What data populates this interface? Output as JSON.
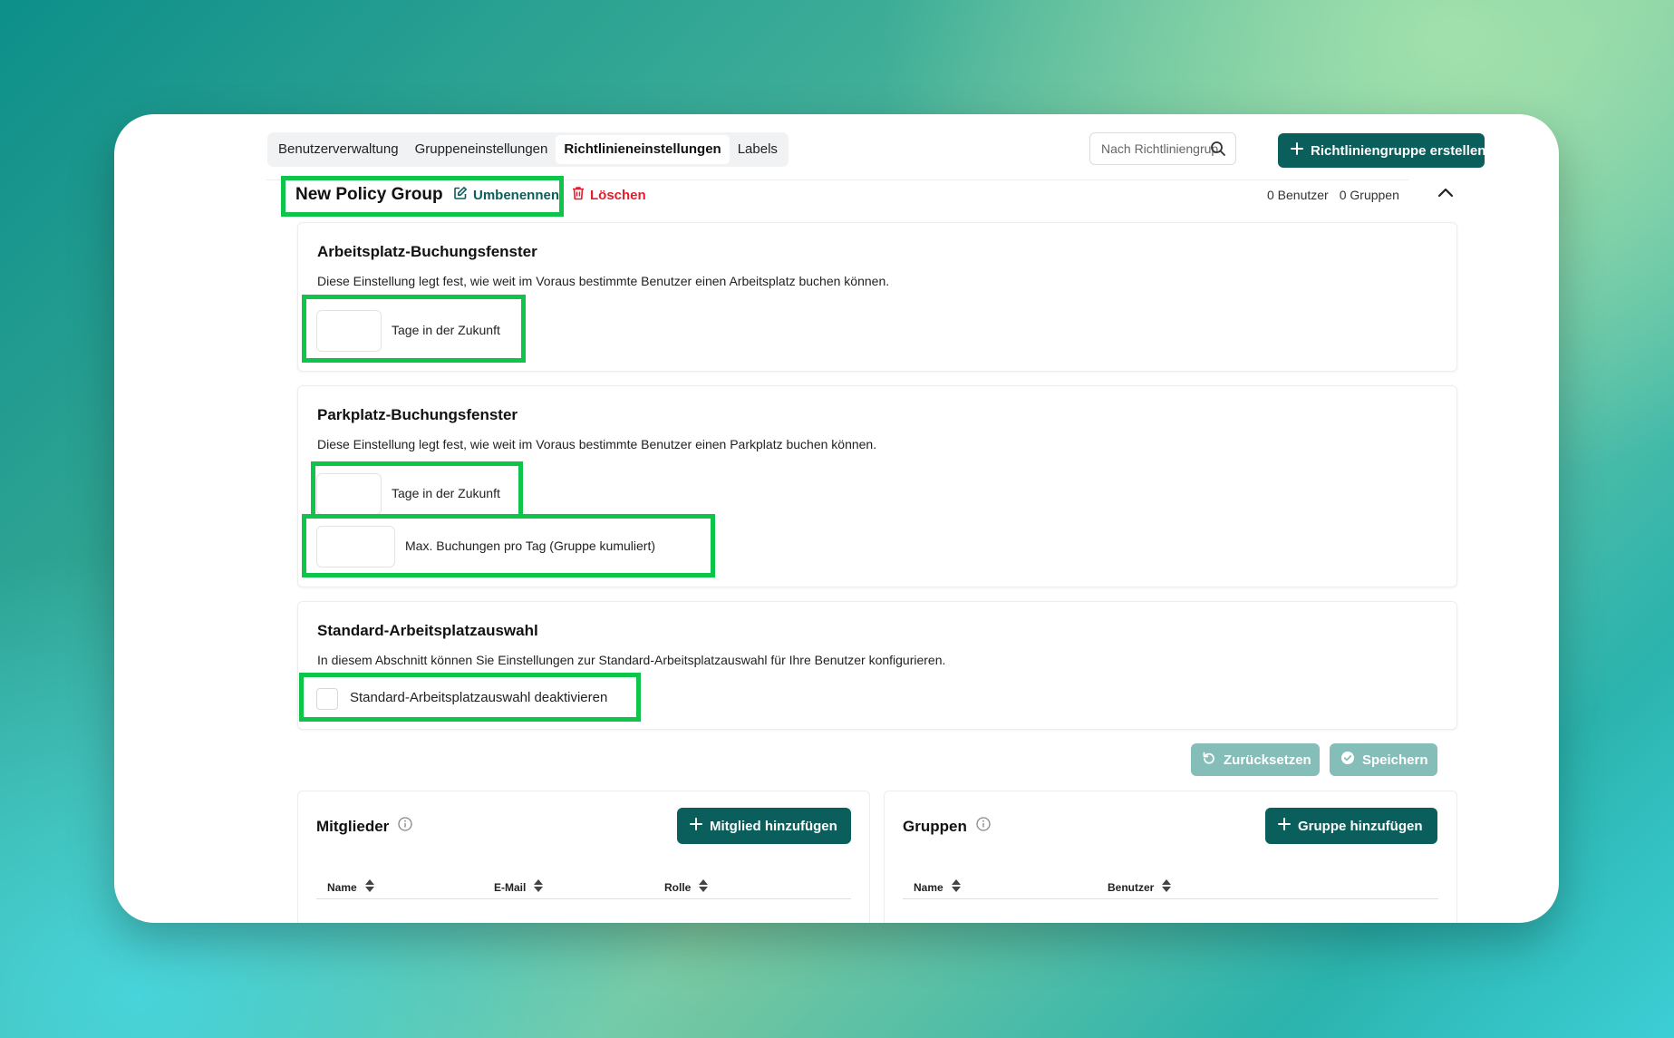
{
  "tabs": [
    {
      "label": "Benutzerverwaltung",
      "active": false
    },
    {
      "label": "Gruppeneinstellungen",
      "active": false
    },
    {
      "label": "Richtlinieneinstellungen",
      "active": true
    },
    {
      "label": "Labels",
      "active": false
    }
  ],
  "search": {
    "placeholder": "Nach Richtliniengruppen suchen",
    "icon": "search-icon"
  },
  "create_button": {
    "label": "Richtliniengruppe erstellen",
    "icon": "plus-icon"
  },
  "group": {
    "title": "New Policy Group",
    "rename_label": "Umbenennen",
    "delete_label": "Löschen",
    "users_count": "0 Benutzer",
    "groups_count": "0 Gruppen"
  },
  "workplace_window": {
    "title": "Arbeitsplatz-Buchungsfenster",
    "description": "Diese Einstellung legt fest, wie weit im Voraus bestimmte Benutzer einen Arbeitsplatz buchen können.",
    "days_label": "Tage in der Zukunft",
    "days_value": ""
  },
  "parking_window": {
    "title": "Parkplatz-Buchungsfenster",
    "description": "Diese Einstellung legt fest, wie weit im Voraus bestimmte Benutzer einen Parkplatz buchen können.",
    "days_label": "Tage in der Zukunft",
    "days_value": "",
    "max_label": "Max. Buchungen pro Tag (Gruppe kumuliert)",
    "max_value": ""
  },
  "default_workplace": {
    "title": "Standard-Arbeitsplatzauswahl",
    "description": "In diesem Abschnitt können Sie Einstellungen zur Standard-Arbeitsplatzauswahl für Ihre Benutzer konfigurieren.",
    "checkbox_label": "Standard-Arbeitsplatzauswahl deaktivieren",
    "checked": false
  },
  "actions": {
    "reset_label": "Zurücksetzen",
    "save_label": "Speichern"
  },
  "members": {
    "title": "Mitglieder",
    "add_label": "Mitglied hinzufügen",
    "columns": [
      "Name",
      "E-Mail",
      "Rolle"
    ]
  },
  "groups_panel": {
    "title": "Gruppen",
    "add_label": "Gruppe hinzufügen",
    "columns": [
      "Name",
      "Benutzer"
    ]
  },
  "colors": {
    "primary": "#0a5f5c",
    "danger": "#e11d2b",
    "highlight": "#0ec44a",
    "disabled": "#85bdb8"
  }
}
